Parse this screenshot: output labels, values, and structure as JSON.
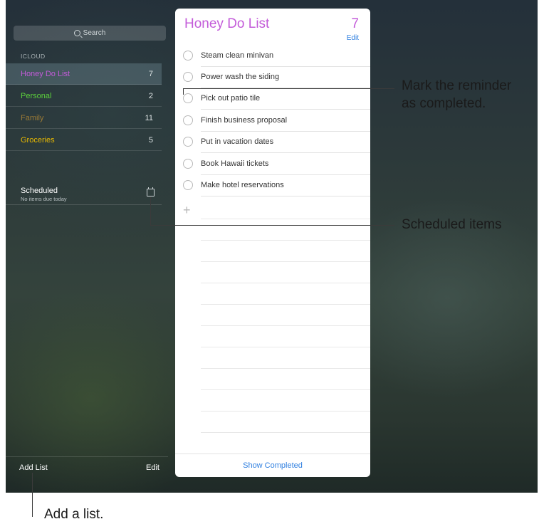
{
  "sidebar": {
    "search_placeholder": "Search",
    "section_label": "ICLOUD",
    "lists": [
      {
        "name": "Honey Do List",
        "count": "7",
        "color": "#c35bd9"
      },
      {
        "name": "Personal",
        "count": "2",
        "color": "#5ccf3c"
      },
      {
        "name": "Family",
        "count": "11",
        "color": "#9a7a36"
      },
      {
        "name": "Groceries",
        "count": "5",
        "color": "#e6b800"
      }
    ],
    "scheduled_title": "Scheduled",
    "scheduled_subtitle": "No items due today",
    "add_list_label": "Add List",
    "edit_label": "Edit"
  },
  "panel": {
    "title": "Honey Do List",
    "count": "7",
    "edit_label": "Edit",
    "items": [
      "Steam clean minivan",
      "Power wash the siding",
      "Pick out patio tile",
      "Finish business proposal",
      "Put in vacation dates",
      "Book Hawaii tickets",
      "Make hotel reservations"
    ],
    "add_icon": "+",
    "show_completed_label": "Show Completed"
  },
  "callouts": {
    "complete_line1": "Mark the reminder",
    "complete_line2": "as completed.",
    "scheduled": "Scheduled items",
    "add_list": "Add a list."
  }
}
